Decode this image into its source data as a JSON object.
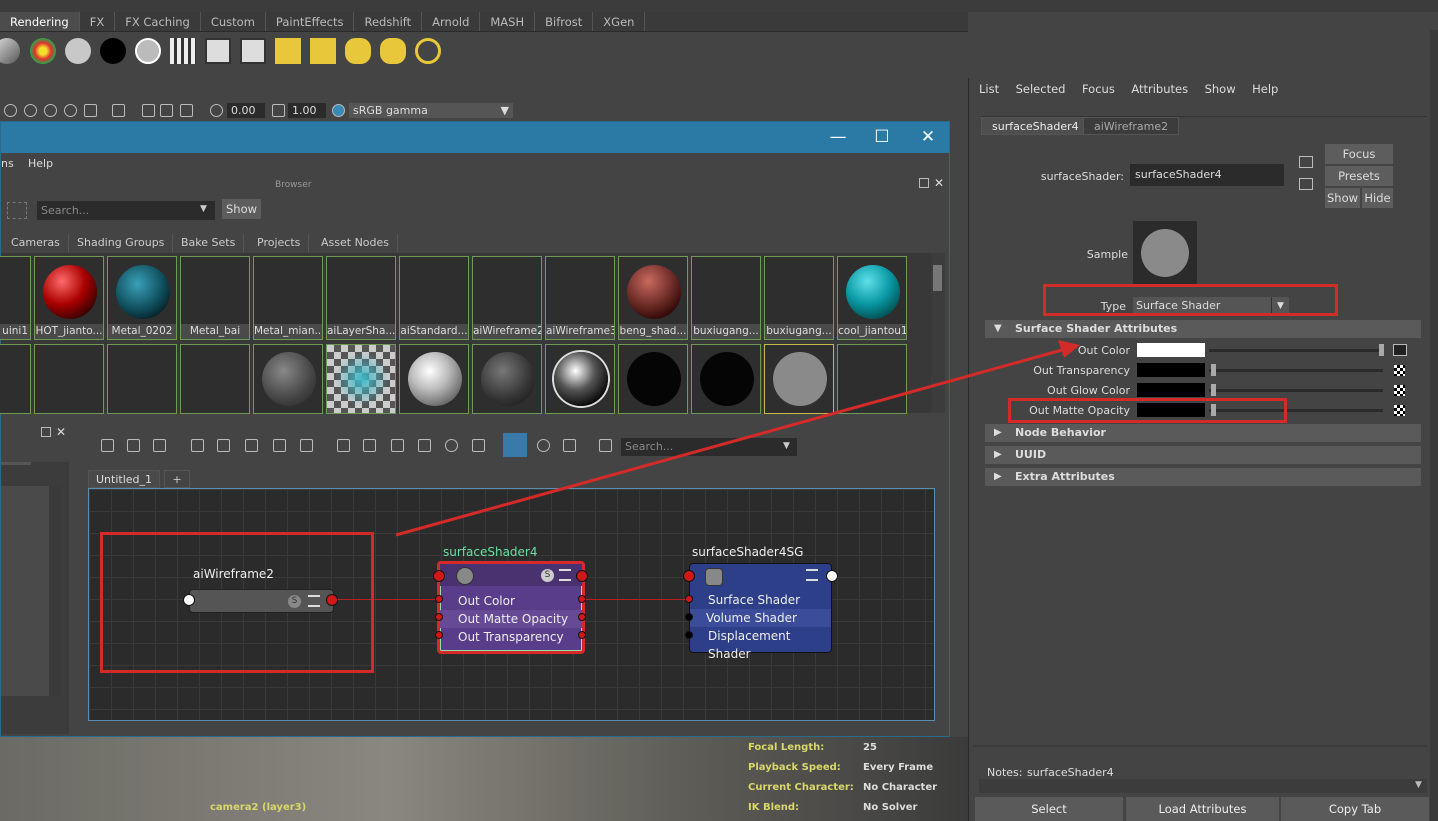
{
  "shelf": {
    "tabs": [
      "Rendering",
      "FX",
      "FX Caching",
      "Custom",
      "PaintEffects",
      "Redshift",
      "Arnold",
      "MASH",
      "Bifrost",
      "XGen"
    ],
    "active_tab": "Rendering"
  },
  "viewport_toolbar": {
    "exposure": "0.00",
    "gamma": "1.00",
    "color_space": "sRGB gamma"
  },
  "hypershade": {
    "menu": [
      "ns",
      "Help"
    ],
    "browser_label": "Browser",
    "search_placeholder": "Search...",
    "show_button": "Show",
    "browser_tabs": [
      "Cameras",
      "Shading Groups",
      "Bake Sets",
      "Projects",
      "Asset Nodes"
    ],
    "swatches_row1": [
      "uini1",
      "HOT_jianto...",
      "Metal_0202",
      "Metal_bai",
      "Metal_mian...",
      "aiLayerSha...",
      "aiStandard...",
      "aiWireframe2",
      "aiWireframe3",
      "beng_shad...",
      "buxiugang...",
      "buxiugang...",
      "cool_jiantou1"
    ],
    "node_editor_search_placeholder": "Search...",
    "graph_tab": "Untitled_1",
    "graph_add_tab": "+",
    "nodes": {
      "wireframe": {
        "title": "aiWireframe2"
      },
      "surface": {
        "title": "surfaceShader4",
        "attrs": [
          "Out Color",
          "Out Matte Opacity",
          "Out Transparency"
        ]
      },
      "sg": {
        "title": "surfaceShader4SG",
        "attrs": [
          "Surface Shader",
          "Volume Shader",
          "Displacement Shader"
        ]
      }
    }
  },
  "hud": {
    "camera": "camera2 (layer3)",
    "rows": [
      {
        "label": "Focal Length:",
        "value": "25"
      },
      {
        "label": "Playback Speed:",
        "value": "Every Frame"
      },
      {
        "label": "Current Character:",
        "value": "No Character"
      },
      {
        "label": "IK Blend:",
        "value": "No Solver"
      }
    ]
  },
  "attribute_editor": {
    "menu": [
      "List",
      "Selected",
      "Focus",
      "Attributes",
      "Show",
      "Help"
    ],
    "tabs": [
      "surfaceShader4",
      "aiWireframe2"
    ],
    "name_label": "surfaceShader:",
    "name_value": "surfaceShader4",
    "focus_button": "Focus",
    "presets_button": "Presets",
    "show_button": "Show",
    "hide_button": "Hide",
    "sample_label": "Sample",
    "type_label": "Type",
    "type_value": "Surface Shader",
    "sections": {
      "surface_attrs": "Surface Shader Attributes",
      "node_behavior": "Node Behavior",
      "uuid": "UUID",
      "extra": "Extra Attributes"
    },
    "attrs": [
      {
        "label": "Out Color",
        "color": "#ffffff"
      },
      {
        "label": "Out Transparency",
        "color": "#000000"
      },
      {
        "label": "Out Glow Color",
        "color": "#000000"
      },
      {
        "label": "Out Matte Opacity",
        "color": "#000000"
      }
    ],
    "notes_label": "Notes:",
    "notes_value": "surfaceShader4",
    "bottom_buttons": [
      "Select",
      "Load Attributes",
      "Copy Tab"
    ]
  },
  "colors": {
    "annotation_red": "#d42a2a",
    "title_blue": "#2b7aa6",
    "surface_node": "#5a3d8a",
    "sg_node": "#2e3f8a"
  }
}
